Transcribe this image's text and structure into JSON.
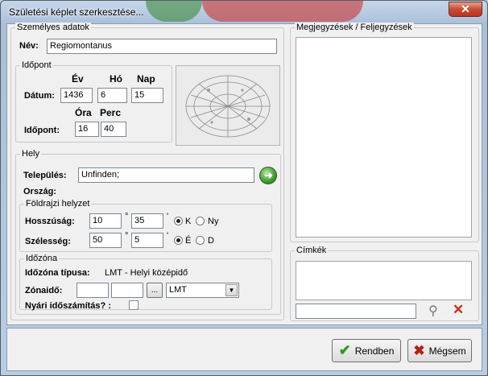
{
  "window": {
    "title": "Születési képlet szerkesztése..."
  },
  "personal": {
    "legend": "Személyes adatok",
    "name_label": "Név:",
    "name_value": "Regiomontanus"
  },
  "time": {
    "legend": "Időpont",
    "year_header": "Év",
    "month_header": "Hó",
    "day_header": "Nap",
    "date_label": "Dátum:",
    "year": "1436",
    "month": "6",
    "day": "15",
    "hour_header": "Óra",
    "minute_header": "Perc",
    "time_label": "Időpont:",
    "hour": "16",
    "minute": "40"
  },
  "place": {
    "legend": "Hely",
    "settlement_label": "Település:",
    "settlement_value": "Unfinden;",
    "country_label": "Ország:"
  },
  "geo": {
    "legend": "Földrajzi helyzet",
    "lon_label": "Hosszúság:",
    "lon_deg": "10",
    "lon_min": "35",
    "east": "K",
    "west": "Ny",
    "lat_label": "Szélesség:",
    "lat_deg": "50",
    "lat_min": "5",
    "north": "É",
    "south": "D",
    "deg_sym": "°",
    "min_sym": "'"
  },
  "timezone": {
    "legend": "Időzóna",
    "type_label": "Időzóna típusa:",
    "type_value": "LMT - Helyi középidő",
    "zone_label": "Zónaidő:",
    "zone_h": "",
    "zone_m": "",
    "browse": "...",
    "zone_select": "LMT",
    "dst_label": "Nyári időszámítás? :"
  },
  "notes": {
    "legend": "Megjegyzések / Feljegyzések",
    "value": ""
  },
  "tags": {
    "legend": "Címkék",
    "list": "",
    "input": ""
  },
  "buttons": {
    "ok": "Rendben",
    "cancel": "Mégsem"
  }
}
